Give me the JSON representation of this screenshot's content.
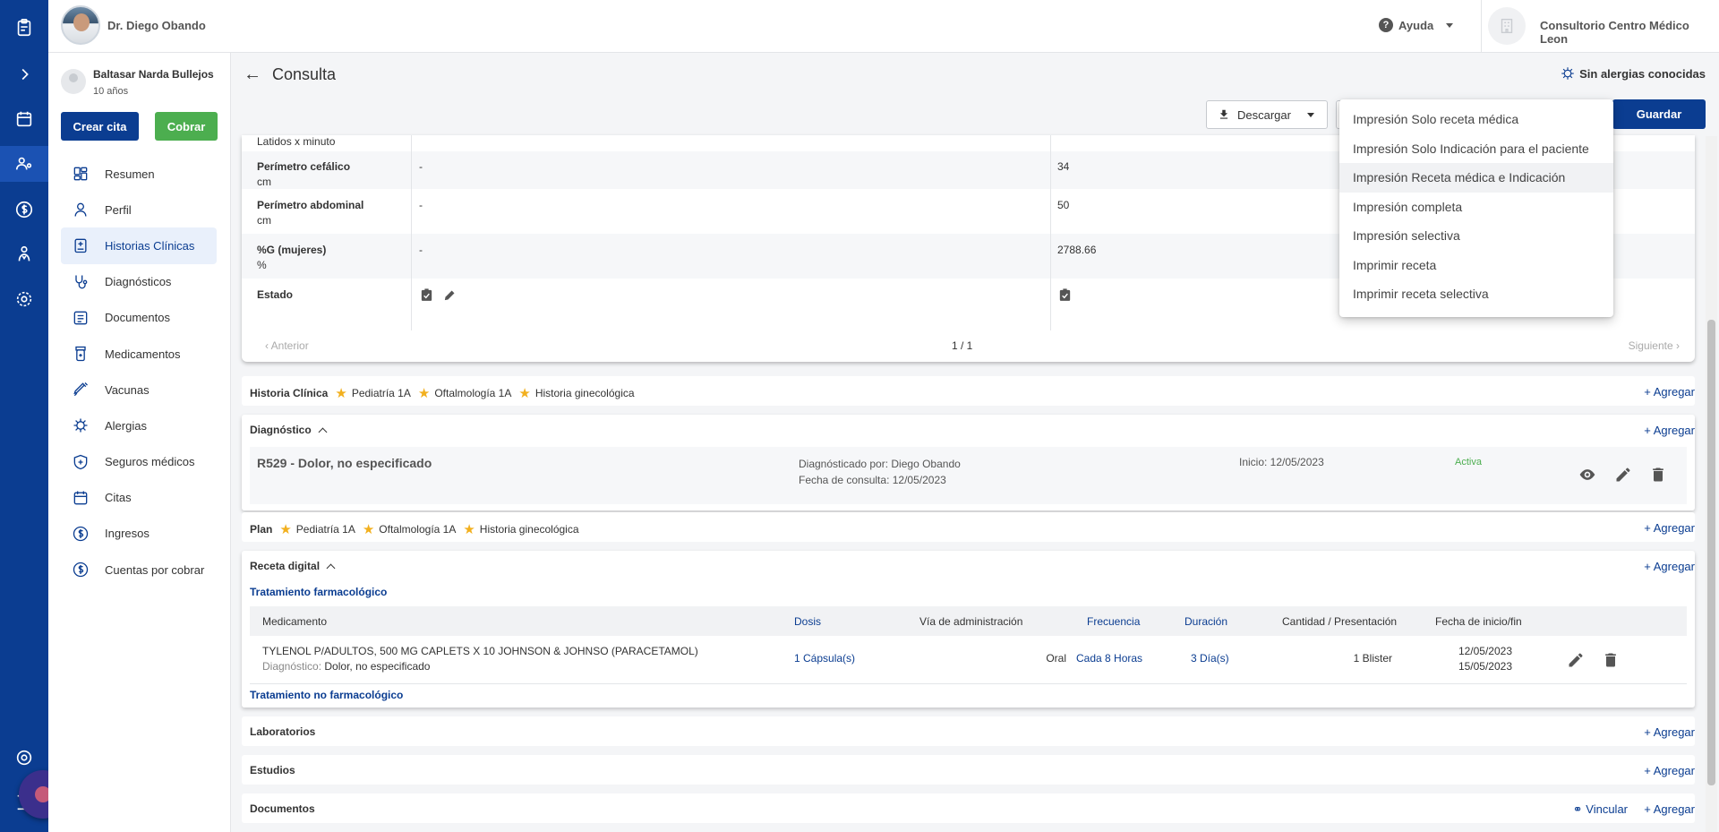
{
  "header": {
    "doctor_name": "Dr. Diego Obando",
    "help_label": "Ayuda",
    "clinic_name": "Consultorio Centro Médico Leon"
  },
  "rail_icons": [
    "clipboard-icon",
    "expand-icon",
    "calendar-icon",
    "patients-icon",
    "billing-icon",
    "doctor-icon",
    "settings-icon",
    "support-icon",
    "logout-icon"
  ],
  "patient": {
    "name": "Baltasar Narda Bullejos",
    "age": "10 años",
    "create_appointment": "Crear cita",
    "charge": "Cobrar"
  },
  "menu": [
    {
      "label": "Resumen",
      "icon": "dashboard-icon"
    },
    {
      "label": "Perfil",
      "icon": "person-icon"
    },
    {
      "label": "Historias Clínicas",
      "icon": "clinical-history-icon",
      "active": true
    },
    {
      "label": "Diagnósticos",
      "icon": "stethoscope-icon"
    },
    {
      "label": "Documentos",
      "icon": "document-icon"
    },
    {
      "label": "Medicamentos",
      "icon": "medicine-icon"
    },
    {
      "label": "Vacunas",
      "icon": "syringe-icon"
    },
    {
      "label": "Alergias",
      "icon": "allergy-icon"
    },
    {
      "label": "Seguros médicos",
      "icon": "shield-icon"
    },
    {
      "label": "Citas",
      "icon": "calendar-icon"
    },
    {
      "label": "Ingresos",
      "icon": "dollar-icon"
    },
    {
      "label": "Cuentas por cobrar",
      "icon": "dollar-icon"
    }
  ],
  "page": {
    "title": "Consulta",
    "allergies": "Sin alergias conocidas",
    "download_label": "Descargar",
    "save_label": "Guardar"
  },
  "vitals": {
    "rows": [
      {
        "label": "Latidos x minuto",
        "unit": "",
        "v1": "",
        "v2": ""
      },
      {
        "label": "Perímetro cefálico",
        "unit": "cm",
        "v1": "-",
        "v2": "34"
      },
      {
        "label": "Perímetro abdominal",
        "unit": "cm",
        "v1": "-",
        "v2": "50"
      },
      {
        "label": "%G (mujeres)",
        "unit": "%",
        "v1": "-",
        "v2": "2788.66"
      },
      {
        "label": "Estado",
        "unit": "",
        "v1": "",
        "v2": ""
      }
    ],
    "prev": "Anterior",
    "page": "1 / 1",
    "next": "Siguiente"
  },
  "sections": {
    "add_label": "+ Agregar",
    "link_label": "Vincular",
    "historia": {
      "title": "Historia Clínica",
      "tags": [
        "Pediatría 1A",
        "Oftalmología 1A",
        "Historia ginecológica"
      ]
    },
    "diagnostico": {
      "title": "Diagnóstico",
      "code": "R529 - Dolor, no especificado",
      "by": "Diagnósticado por: Diego Obando",
      "date": "Fecha de consulta: 12/05/2023",
      "start": "Inicio: 12/05/2023",
      "status": "Activa"
    },
    "plan": {
      "title": "Plan",
      "tags": [
        "Pediatría 1A",
        "Oftalmología 1A",
        "Historia ginecológica"
      ]
    },
    "receta": {
      "title": "Receta digital",
      "pharma": "Tratamiento farmacológico",
      "nonpharma": "Tratamiento no farmacológico",
      "columns": {
        "med": "Medicamento",
        "dose": "Dosis",
        "route": "Vía de administración",
        "freq": "Frecuencia",
        "duration": "Duración",
        "qty": "Cantidad / Presentación",
        "dates": "Fecha de inicio/fin"
      },
      "row": {
        "med": "TYLENOL P/ADULTOS, 500 MG CAPLETS X 10 JOHNSON & JOHNSO (PARACETAMOL)",
        "diag_label": "Diagnóstico:",
        "diag_value": "Dolor, no especificado",
        "dose": "1 Cápsula(s)",
        "route": "Oral",
        "freq": "Cada 8 Horas",
        "duration": "3 Día(s)",
        "qty": "1 Blister",
        "start": "12/05/2023",
        "end": "15/05/2023"
      }
    },
    "laboratorios": {
      "title": "Laboratorios"
    },
    "estudios": {
      "title": "Estudios"
    },
    "documentos": {
      "title": "Documentos"
    }
  },
  "print_menu": [
    "Impresión Solo receta médica",
    "Impresión Solo Indicación para el paciente",
    "Impresión Receta médica e Indicación",
    "Impresión completa",
    "Impresión selectiva",
    "Imprimir receta",
    "Imprimir receta selectiva"
  ],
  "colors": {
    "primary": "#0b3d91",
    "success": "#4cae4f",
    "star": "#f2b01e"
  }
}
